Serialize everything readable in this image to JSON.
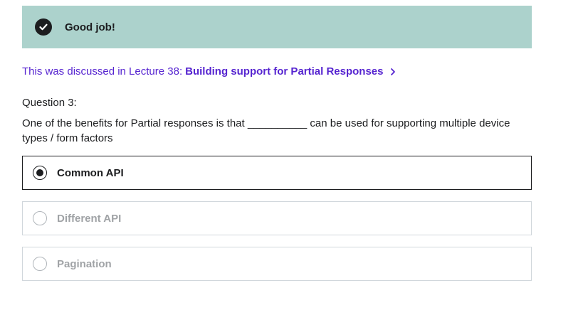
{
  "banner": {
    "message": "Good job!",
    "icon": "check-circle-icon"
  },
  "lecture": {
    "prefix": "This was discussed in Lecture 38:",
    "link_text": "Building support for Partial Responses",
    "link_color": "#5624d0"
  },
  "question": {
    "label": "Question 3:",
    "text": "One of the benefits for Partial responses is that __________ can be used for supporting multiple device types / form factors"
  },
  "options": [
    {
      "label": "Common API",
      "selected": true
    },
    {
      "label": "Different API",
      "selected": false
    },
    {
      "label": "Pagination",
      "selected": false
    }
  ],
  "colors": {
    "banner_bg": "#acd2cc",
    "accent": "#5624d0",
    "text": "#1c1d1f"
  }
}
